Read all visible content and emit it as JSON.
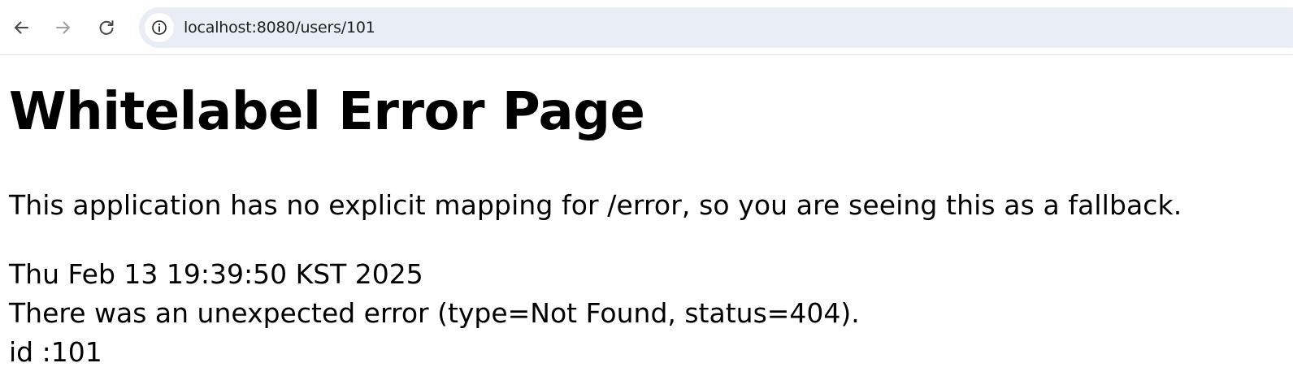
{
  "browser": {
    "address_bar": {
      "url": "localhost:8080/users/101"
    },
    "icons": {
      "back": "arrow-left-icon",
      "forward": "arrow-right-icon",
      "reload": "reload-icon",
      "site_info": "info-icon"
    }
  },
  "page": {
    "title": "Whitelabel Error Page",
    "description": "This application has no explicit mapping for /error, so you are seeing this as a fallback.",
    "timestamp": "Thu Feb 13 19:39:50 KST 2025",
    "error_message": "There was an unexpected error (type=Not Found, status=404).",
    "detail": "id :101"
  },
  "colors": {
    "omnibox_bg": "#e9eef6",
    "icon_active": "#474747",
    "icon_disabled": "#a0a0a0"
  }
}
